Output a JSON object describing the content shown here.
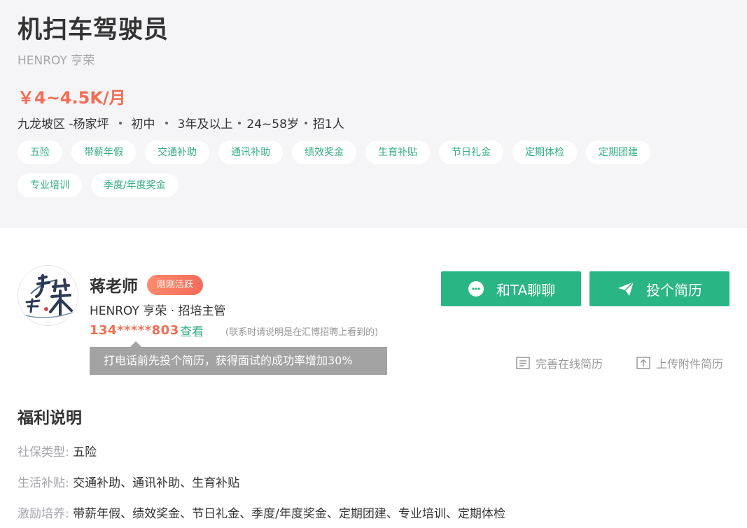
{
  "job": {
    "title": "机扫车驾驶员",
    "company": "HENROY 亨荣",
    "salary": "￥4~4.5K/月",
    "location": "九龙坡区 -杨家坪",
    "education": "初中",
    "experience": "3年及以上",
    "age": "24~58岁",
    "headcount": "招1人",
    "tags": [
      "五险",
      "带薪年假",
      "交通补助",
      "通讯补助",
      "绩效奖金",
      "生育补贴",
      "节日礼金",
      "定期体检",
      "定期团建",
      "专业培训",
      "季度/年度奖金"
    ]
  },
  "hr": {
    "name": "蒋老师",
    "badge": "刚刚活跃",
    "company_role": "HENROY 亨荣 · 招培主管",
    "phone": "134*****803",
    "phone_view": "查看",
    "phone_note": "(联系时请说明是在汇博招聘上看到的)",
    "tooltip": "打电话前先投个简历，获得面试的成功率增加30%",
    "avatar_icon": "company-logo-icon"
  },
  "actions": {
    "chat_label": "和TA聊聊",
    "apply_label": "投个简历",
    "online_resume_label": "完善在线简历",
    "upload_resume_label": "上传附件简历"
  },
  "benefits": {
    "title": "福利说明",
    "rows": [
      {
        "key": "社保类型:",
        "value": "五险"
      },
      {
        "key": "生活补贴:",
        "value": "交通补助、通讯补助、生育补贴"
      },
      {
        "key": "激励培养:",
        "value": "带薪年假、绩效奖金、节日礼金、季度/年度奖金、定期团建、专业培训、定期体检"
      }
    ]
  },
  "colors": {
    "accent_green": "#2ab584",
    "salary_red": "#f26d53",
    "header_bg": "#f5f5f8"
  }
}
